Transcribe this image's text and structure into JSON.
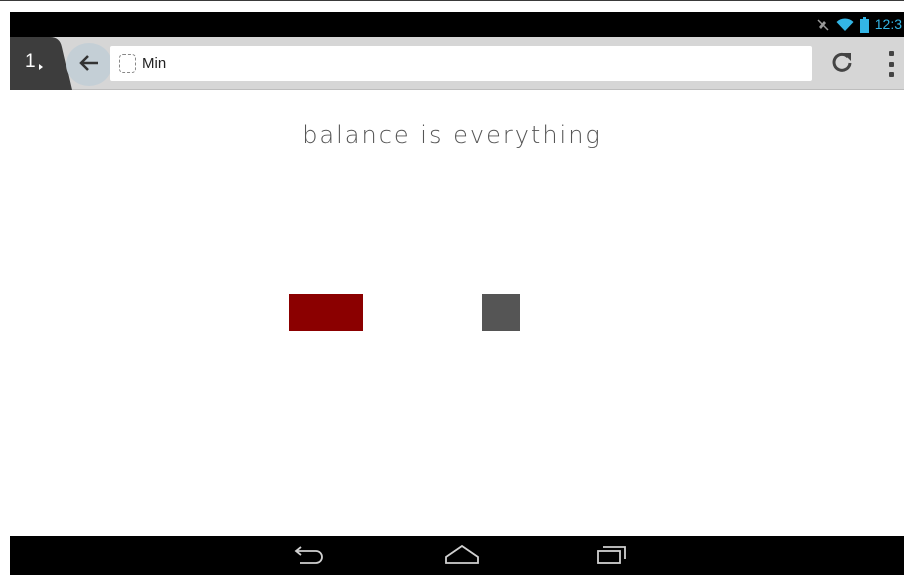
{
  "status_bar": {
    "time": "12:3",
    "icons": [
      "mute-icon",
      "wifi-icon",
      "battery-icon"
    ],
    "accent_color": "#33b5e5"
  },
  "browser": {
    "tab_count": "1",
    "icons": [
      "chevron-right-icon",
      "back-arrow-icon",
      "page-icon",
      "reload-icon",
      "overflow-menu-icon"
    ],
    "url_text": "Min"
  },
  "page": {
    "headline": "balance is everything",
    "blocks": [
      {
        "name": "red-block",
        "color": "#8b0000"
      },
      {
        "name": "gray-block",
        "color": "#555555"
      }
    ]
  },
  "nav_bar": {
    "icons": [
      "back-nav-icon",
      "home-icon",
      "recent-apps-icon"
    ]
  }
}
